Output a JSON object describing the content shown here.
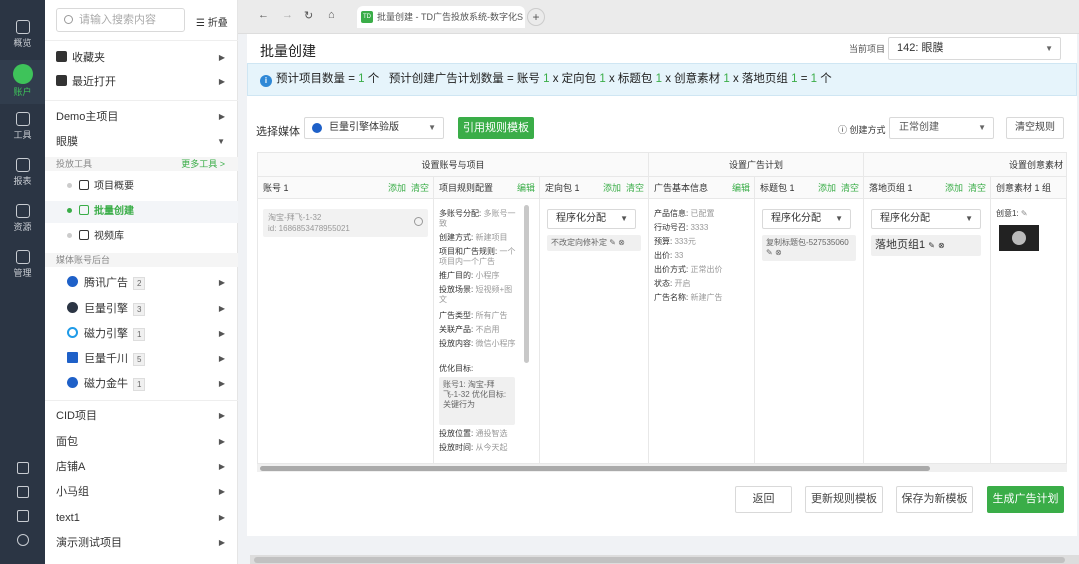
{
  "rail": {
    "items": [
      {
        "label": "概览",
        "icon": "overview-icon"
      },
      {
        "label": "账户",
        "icon": "account-icon"
      },
      {
        "label": "工具",
        "icon": "tools-icon"
      },
      {
        "label": "报表",
        "icon": "report-icon"
      },
      {
        "label": "资源",
        "icon": "resource-icon"
      },
      {
        "label": "管理",
        "icon": "manage-icon"
      }
    ]
  },
  "sidebar": {
    "search_placeholder": "请输入搜索内容",
    "fold_label": "折叠",
    "favorites": "收藏夹",
    "recent": "最近打开",
    "demo_project": "Demo主项目",
    "eye_project": "眼膜",
    "tools_section": "投放工具",
    "more_tools": "更多工具 >",
    "sub_items": [
      "项目概要",
      "批量创建",
      "视频库"
    ],
    "media_section": "媒体账号后台",
    "media": [
      {
        "name": "腾讯广告",
        "count": "2",
        "color": "#1e60c8"
      },
      {
        "name": "巨量引擎",
        "count": "3",
        "color": "#2b3544"
      },
      {
        "name": "磁力引擎",
        "count": "1",
        "color": "#1f9be8"
      },
      {
        "name": "巨量千川",
        "count": "5",
        "color": "#1e60c8"
      },
      {
        "name": "磁力金牛",
        "count": "1",
        "color": "#1e60c8"
      }
    ],
    "bottom": [
      "CID项目",
      "面包",
      "店铺A",
      "小马组",
      "text1",
      "演示测试项目"
    ]
  },
  "browser": {
    "tab_title": "批量创建 - TD广告投放系统-数字化S",
    "tab_icon": "TD"
  },
  "page": {
    "title": "批量创建",
    "project_label": "当前项目",
    "project_value": "142: 眼膜",
    "info_prefix": "预计项目数量 = ",
    "info_proj": "1",
    "info_unit1": " 个",
    "info_mid": "预计创建广告计划数量 = 账号 ",
    "n_account": "1",
    "info_x_targeting": " x 定向包 ",
    "n_targeting": "1",
    "info_x_title": " x 标题包 ",
    "n_title": "1",
    "info_x_creative": " x 创意素材 ",
    "n_creative": "1",
    "info_x_landing": " x 落地页组 ",
    "n_landing": "1",
    "info_eq": " = ",
    "n_total": "1",
    "info_unit2": " 个",
    "media_label": "选择媒体",
    "media_value": "巨量引擎体验版",
    "apply_template": "引用规则模板",
    "create_mode_label": "创建方式",
    "create_mode_value": "正常创建",
    "clear_rules": "清空规则"
  },
  "table": {
    "groups": [
      "设置账号与项目",
      "设置广告计划",
      "设置创意素材"
    ],
    "columns": {
      "account": {
        "title": "账号 1",
        "add": "添加",
        "clear": "清空"
      },
      "project_rule": {
        "title": "项目规则配置",
        "edit": "编辑"
      },
      "targeting": {
        "title": "定向包 1",
        "add": "添加",
        "clear": "清空"
      },
      "ad_basic": {
        "title": "广告基本信息",
        "edit": "编辑"
      },
      "title_pkg": {
        "title": "标题包 1",
        "add": "添加",
        "clear": "清空"
      },
      "landing": {
        "title": "落地页组 1",
        "add": "添加",
        "clear": "清空"
      },
      "creative": {
        "title": "创意素材 1 组"
      }
    },
    "account_entry": {
      "name": "淘宝-拜飞-1-32",
      "id": "id: 1686853478955021"
    },
    "project_rules": [
      {
        "k": "多账号分配:",
        "v": "多账号一致"
      },
      {
        "k": "创建方式:",
        "v": "新建项目"
      },
      {
        "k": "项目和广告规则:",
        "v": "一个项目内一个广告"
      },
      {
        "k": "推广目的:",
        "v": "小程序"
      },
      {
        "k": "投放场景:",
        "v": "短视频+图文"
      },
      {
        "k": "广告类型:",
        "v": "所有广告"
      },
      {
        "k": "关联产品:",
        "v": "不启用"
      },
      {
        "k": "投放内容:",
        "v": "微信小程序"
      },
      {
        "k": "优化目标:",
        "v": ""
      }
    ],
    "optimize_tag": "账号1: 淘宝-拜飞-1-32 优化目标: 关键行为",
    "project_rules_tail": [
      {
        "k": "投放位置:",
        "v": "通投智选"
      },
      {
        "k": "投放时间:",
        "v": "从今天起"
      }
    ],
    "program_alloc": "程序化分配",
    "targeting_tag": "不改定向修补定",
    "ad_basic": [
      {
        "k": "产品信息:",
        "v": "已配置"
      },
      {
        "k": "行动号召:",
        "v": "3333"
      },
      {
        "k": "预算:",
        "v": "333元"
      },
      {
        "k": "出价:",
        "v": "33"
      },
      {
        "k": "出价方式:",
        "v": "正常出价"
      },
      {
        "k": "状态:",
        "v": "开启"
      },
      {
        "k": "广告名称:",
        "v": "新建广告"
      }
    ],
    "title_tag": "复制标题包-527535060",
    "landing_group": "落地页组1",
    "creative_label": "创意1:"
  },
  "footer": {
    "back": "返回",
    "update_template": "更新规则模板",
    "save_template": "保存为新模板",
    "generate": "生成广告计划"
  }
}
